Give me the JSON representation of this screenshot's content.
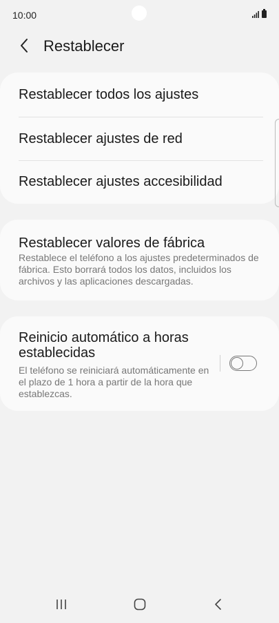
{
  "status_bar": {
    "time": "10:00"
  },
  "header": {
    "title": "Restablecer"
  },
  "reset_options": {
    "items": [
      {
        "label": "Restablecer todos los ajustes"
      },
      {
        "label": "Restablecer ajustes de red"
      },
      {
        "label": "Restablecer ajustes accesibilidad"
      }
    ]
  },
  "factory_reset": {
    "title": "Restablecer valores de fábrica",
    "description": "Restablece el teléfono a los ajustes predeterminados de fábrica. Esto borrará todos los datos, incluidos los archivos y las aplicaciones descargadas."
  },
  "auto_restart": {
    "title": "Reinicio automático a horas establecidas",
    "description": "El teléfono se reiniciará automáticamente en el plazo de 1 hora a partir de la hora que establezcas.",
    "enabled": false
  },
  "icons": {
    "back": "chevron-left-icon",
    "signal": "signal-icon",
    "battery": "battery-icon",
    "nav_recents": "recents-icon",
    "nav_home": "home-icon",
    "nav_back": "back-icon"
  },
  "colors": {
    "background": "#f2f2f2",
    "card": "#fafafa",
    "secondary_text": "#777777"
  }
}
